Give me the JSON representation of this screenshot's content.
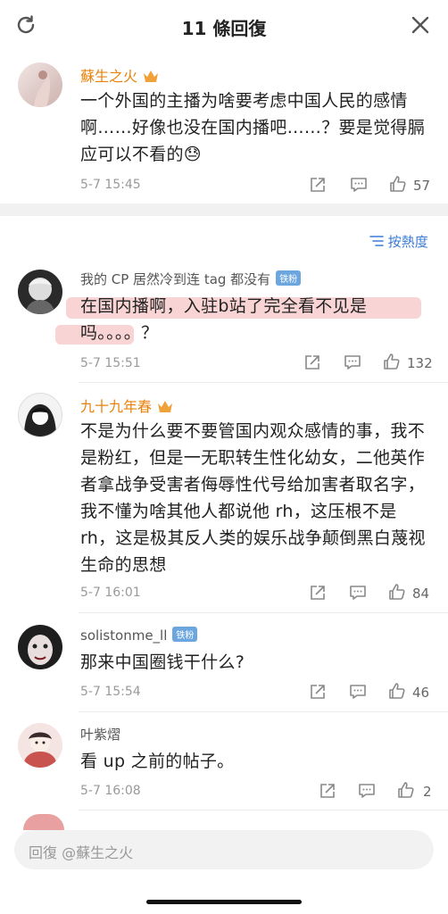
{
  "header": {
    "title": "11 條回復"
  },
  "main": {
    "name": "蘇生之火",
    "text": "一个外国的主播为啥要考虑中国人民的感情啊……好像也没在国内播吧……？要是觉得膈应可以不看的😓",
    "time": "5-7 15:45",
    "likes": "57"
  },
  "sort_label": "按熱度",
  "comments": [
    {
      "name": "我的 CP 居然冷到连 tag 都没有",
      "badge": "铁粉",
      "text": "在国内播啊，入驻b站了完全看不见是吗。。。。？",
      "time": "5-7 15:51",
      "likes": "132"
    },
    {
      "name": "九十九年春",
      "text": "不是为什么要不要管国内观众感情的事，我不是粉红，但是一无职转生性化幼女，二他英作者拿战争受害者侮辱性代号给加害者取名字，我不懂为啥其他人都说他 rh，这压根不是 rh，这是极其反人类的娱乐战争颠倒黑白蔑视生命的思想",
      "time": "5-7 16:01",
      "likes": "84"
    },
    {
      "name": "solistonme_ll",
      "badge": "铁粉",
      "text": "那来中国圈钱干什么?",
      "time": "5-7 15:54",
      "likes": "46"
    },
    {
      "name": "叶紫熠",
      "text": "看 up 之前的帖子。",
      "time": "5-7 16:08",
      "likes": "2"
    }
  ],
  "reply": {
    "placeholder": "回復 @蘇生之火"
  },
  "colors": {
    "accent": "#e8820c",
    "link": "#3a7bd5",
    "highlight": "#f9d4d4"
  }
}
